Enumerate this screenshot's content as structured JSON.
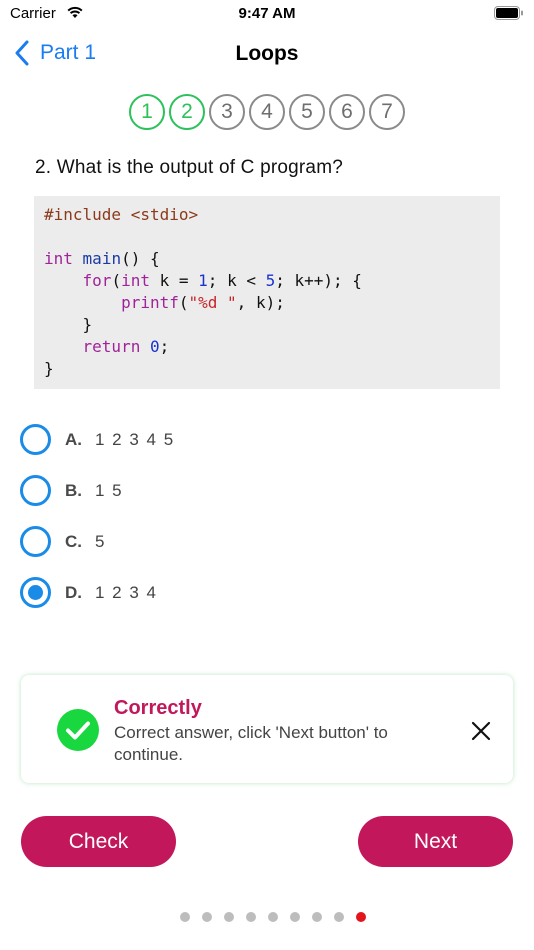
{
  "status_bar": {
    "carrier": "Carrier",
    "time": "9:47 AM"
  },
  "nav": {
    "back_label": "Part 1",
    "title": "Loops"
  },
  "steps": [
    {
      "label": "1",
      "state": "done"
    },
    {
      "label": "2",
      "state": "done"
    },
    {
      "label": "3",
      "state": "pending"
    },
    {
      "label": "4",
      "state": "pending"
    },
    {
      "label": "5",
      "state": "pending"
    },
    {
      "label": "6",
      "state": "pending"
    },
    {
      "label": "7",
      "state": "pending"
    }
  ],
  "question": "2. What is the output of C program?",
  "code": [
    [
      {
        "t": "#include <stdio>",
        "c": "pre"
      }
    ],
    [],
    [
      {
        "t": "int",
        "c": "kw"
      },
      {
        "t": " "
      },
      {
        "t": "main",
        "c": "fn"
      },
      {
        "t": "() {"
      }
    ],
    [
      {
        "t": "    "
      },
      {
        "t": "for",
        "c": "kw"
      },
      {
        "t": "("
      },
      {
        "t": "int",
        "c": "kw"
      },
      {
        "t": " k = "
      },
      {
        "t": "1",
        "c": "num"
      },
      {
        "t": "; k < "
      },
      {
        "t": "5",
        "c": "num"
      },
      {
        "t": "; k++); {"
      }
    ],
    [
      {
        "t": "        "
      },
      {
        "t": "printf",
        "c": "kw"
      },
      {
        "t": "("
      },
      {
        "t": "\"%d \"",
        "c": "str"
      },
      {
        "t": ", k);"
      }
    ],
    [
      {
        "t": "    }"
      }
    ],
    [
      {
        "t": "    "
      },
      {
        "t": "return",
        "c": "kw"
      },
      {
        "t": " "
      },
      {
        "t": "0",
        "c": "num"
      },
      {
        "t": ";"
      }
    ],
    [
      {
        "t": "}"
      }
    ]
  ],
  "options": [
    {
      "letter": "A.",
      "text": "1 2 3 4 5",
      "selected": false
    },
    {
      "letter": "B.",
      "text": "1 5",
      "selected": false
    },
    {
      "letter": "C.",
      "text": "5",
      "selected": false
    },
    {
      "letter": "D.",
      "text": "1 2 3 4",
      "selected": true
    }
  ],
  "feedback": {
    "title": "Correctly",
    "message": "Correct answer, click 'Next button' to continue.",
    "icon": "check-circle-icon",
    "status_color": "#19d73f",
    "title_color": "#c2185b"
  },
  "buttons": {
    "check_label": "Check",
    "next_label": "Next",
    "color": "#c2185b"
  },
  "page_indicator": {
    "total": 9,
    "active_index": 8,
    "active_color": "#e3141b"
  }
}
